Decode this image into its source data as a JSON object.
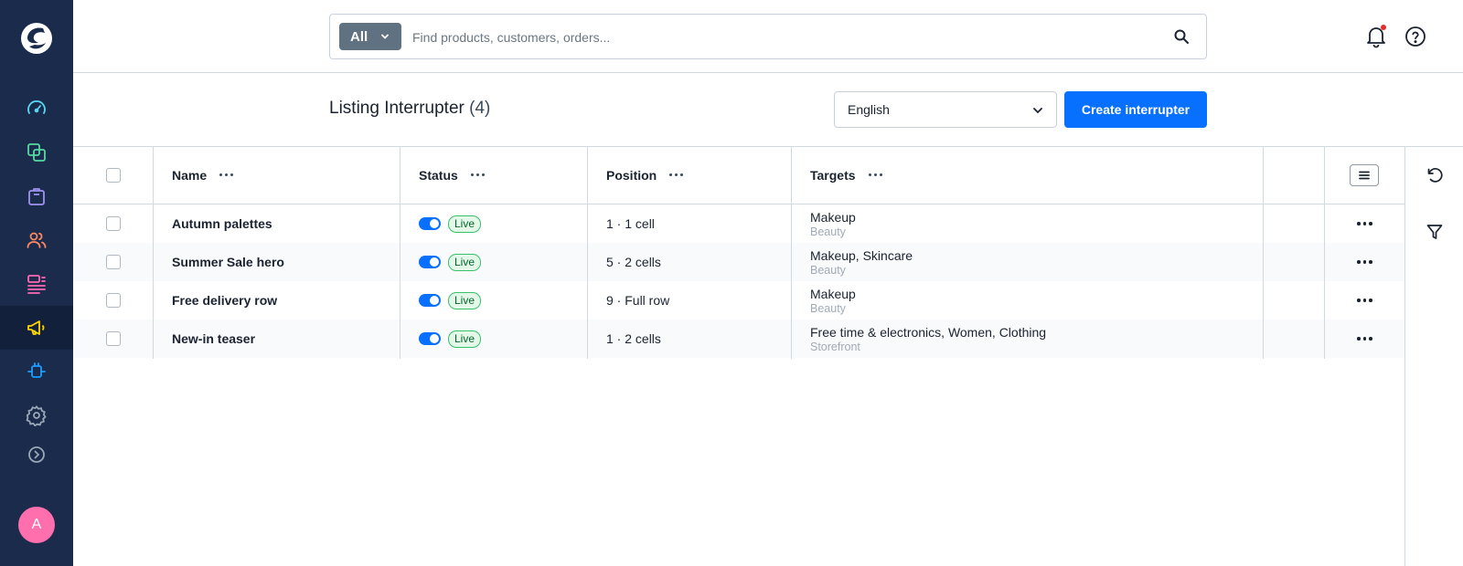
{
  "app": {
    "logo_icon": "shopware-logo-icon",
    "avatar_initial": "A",
    "accent": "#0870ff"
  },
  "sidebar": {
    "items": [
      {
        "name": "dashboard",
        "icon": "gauge-icon",
        "color": "#57d9f4",
        "active": false
      },
      {
        "name": "catalogues",
        "icon": "products-icon",
        "color": "#57d9a3",
        "active": false
      },
      {
        "name": "orders",
        "icon": "shopping-bag-icon",
        "color": "#a092f0",
        "active": false
      },
      {
        "name": "customers",
        "icon": "users-icon",
        "color": "#f88962",
        "active": false
      },
      {
        "name": "content",
        "icon": "content-icon",
        "color": "#ff68b4",
        "active": false
      },
      {
        "name": "marketing",
        "icon": "megaphone-icon",
        "color": "#ffd700",
        "active": true
      },
      {
        "name": "extensions",
        "icon": "plug-icon",
        "color": "#189eff",
        "active": false
      },
      {
        "name": "settings",
        "icon": "gear-icon",
        "color": "#9aa8b5",
        "active": false
      },
      {
        "name": "expand",
        "icon": "chevron-circle-icon",
        "color": "#9aa8b5",
        "active": false
      }
    ]
  },
  "search": {
    "type_label": "All",
    "placeholder": "Find products, customers, orders..."
  },
  "header": {
    "title": "Listing Interrupter",
    "count": "(4)",
    "language": "English",
    "create_label": "Create interrupter"
  },
  "table": {
    "columns": [
      {
        "label": "Name"
      },
      {
        "label": "Status"
      },
      {
        "label": "Position"
      },
      {
        "label": "Targets"
      }
    ],
    "rows": [
      {
        "name": "Autumn palettes",
        "status": "Live",
        "position": "1 · 1 cell",
        "target": "Makeup",
        "target_sub": "Beauty"
      },
      {
        "name": "Summer Sale hero",
        "status": "Live",
        "position": "5 · 2 cells",
        "target": "Makeup, Skincare",
        "target_sub": "Beauty"
      },
      {
        "name": "Free delivery row",
        "status": "Live",
        "position": "9 · Full row",
        "target": "Makeup",
        "target_sub": "Beauty"
      },
      {
        "name": "New-in teaser",
        "status": "Live",
        "position": "1 · 2 cells",
        "target": "Free time & electronics, Women, Clothing",
        "target_sub": "Storefront"
      }
    ]
  }
}
